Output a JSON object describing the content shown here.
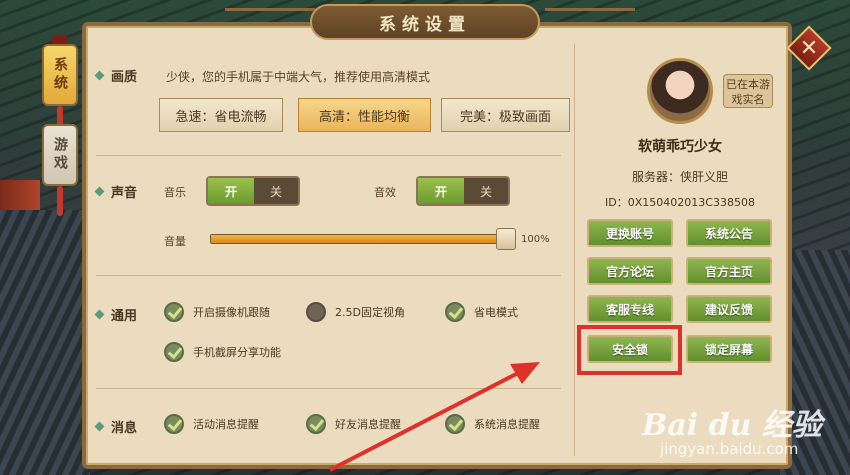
{
  "title": "系统设置",
  "tabs": [
    {
      "label": "系统",
      "active": true
    },
    {
      "label": "游戏",
      "active": false
    }
  ],
  "close_icon": "close-icon",
  "quality": {
    "title": "画质",
    "hint": "少侠，您的手机属于中端大气，推荐使用高清模式",
    "options": [
      {
        "label": "急速：省电流畅",
        "active": false
      },
      {
        "label": "高清：性能均衡",
        "active": true
      },
      {
        "label": "完美：极致画面",
        "active": false
      }
    ]
  },
  "sound": {
    "title": "声音",
    "music_label": "音乐",
    "effects_label": "音效",
    "on_label": "开",
    "off_label": "关",
    "music_on": true,
    "effects_on": true,
    "volume_label": "音量",
    "volume_value": 100,
    "volume_text": "100%"
  },
  "general": {
    "title": "通用",
    "options": [
      {
        "label": "开启摄像机跟随",
        "checked": true
      },
      {
        "label": "2.5D固定视角",
        "checked": false
      },
      {
        "label": "省电模式",
        "checked": true
      },
      {
        "label": "手机截屏分享功能",
        "checked": true
      }
    ]
  },
  "messages": {
    "title": "消息",
    "options": [
      {
        "label": "活动消息提醒",
        "checked": true
      },
      {
        "label": "好友消息提醒",
        "checked": true
      },
      {
        "label": "系统消息提醒",
        "checked": true
      }
    ]
  },
  "profile": {
    "realname_button": "已在本游戏实名",
    "name": "软萌乖巧少女",
    "server": "服务器：侠肝义胆",
    "id": "ID：0X150402013C338508",
    "buttons": [
      "更换账号",
      "系统公告",
      "官方论坛",
      "官方主页",
      "客服专线",
      "建议反馈",
      "安全锁",
      "锁定屏幕"
    ]
  },
  "watermark": {
    "logo": "Bai du 经验",
    "url": "jingyan.baidu.com"
  },
  "colors": {
    "accent_green": "#6c9a2e",
    "highlight_red": "#e0302a",
    "panel": "#ebdcc0"
  }
}
